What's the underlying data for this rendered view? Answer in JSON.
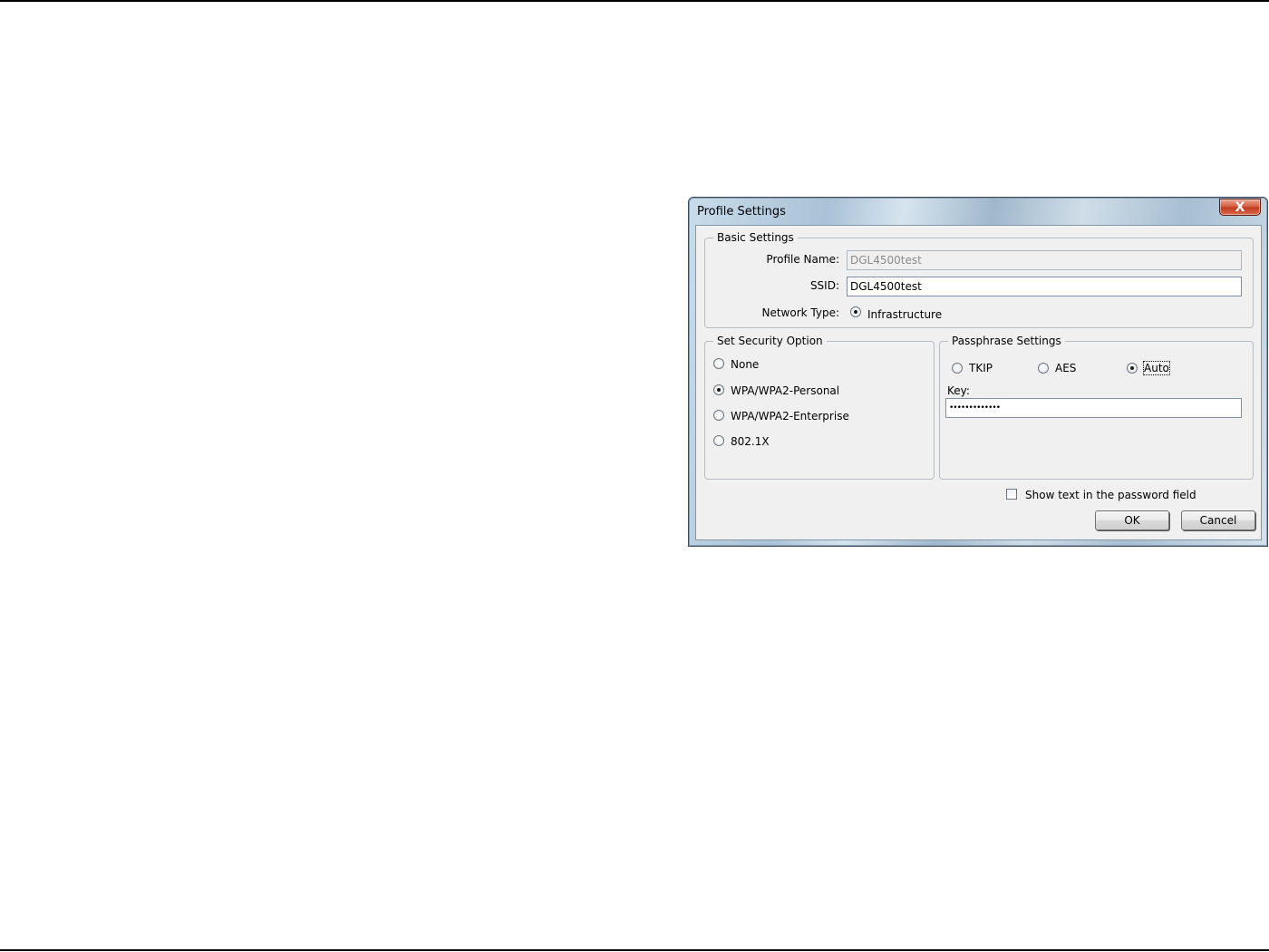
{
  "dialog": {
    "title": "Profile Settings",
    "close_symbol": "X"
  },
  "basic_settings": {
    "legend": "Basic Settings",
    "profile_name_label": "Profile Name:",
    "profile_name_value": "DGL4500test",
    "ssid_label": "SSID:",
    "ssid_value": "DGL4500test",
    "network_type_label": "Network Type:",
    "network_type_option": "Infrastructure"
  },
  "security": {
    "legend": "Set Security Option",
    "options": [
      {
        "label": "None",
        "selected": false
      },
      {
        "label": "WPA/WPA2-Personal",
        "selected": true
      },
      {
        "label": "WPA/WPA2-Enterprise",
        "selected": false
      },
      {
        "label": "802.1X",
        "selected": false
      }
    ]
  },
  "passphrase": {
    "legend": "Passphrase Settings",
    "ciphers": [
      {
        "label": "TKIP",
        "selected": false
      },
      {
        "label": "AES",
        "selected": false
      },
      {
        "label": "Auto",
        "selected": true
      }
    ],
    "key_label": "Key:",
    "key_value": "•••••••••••••"
  },
  "show_text_checkbox": {
    "label": "Show text in the password field",
    "checked": false
  },
  "buttons": {
    "ok": "OK",
    "cancel": "Cancel"
  }
}
